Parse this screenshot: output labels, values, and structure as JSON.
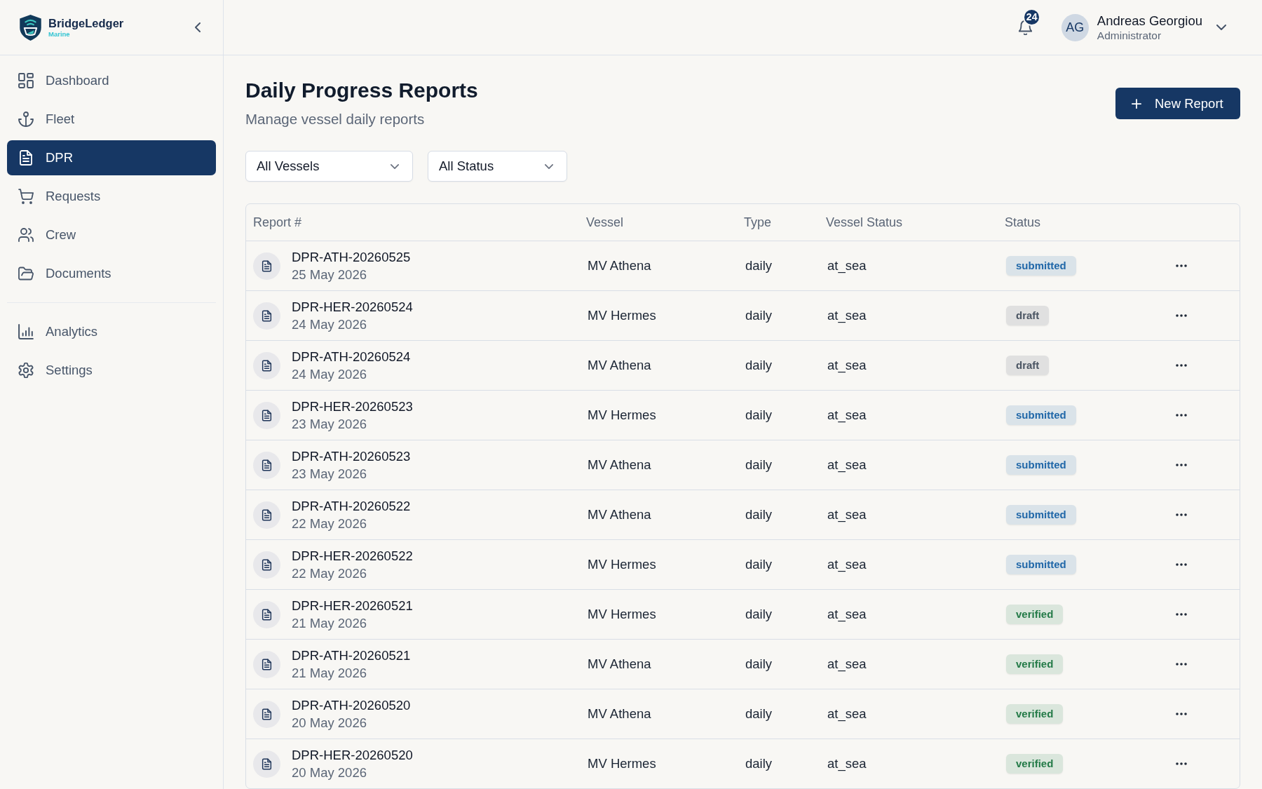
{
  "brand": {
    "name": "BridgeLedger",
    "tagline": "Marine"
  },
  "sidebar": {
    "sections": [
      {
        "items": [
          {
            "label": "Dashboard",
            "selected": false
          },
          {
            "label": "Fleet",
            "selected": false
          },
          {
            "label": "DPR",
            "selected": true
          },
          {
            "label": "Requests",
            "selected": false
          },
          {
            "label": "Crew",
            "selected": false
          },
          {
            "label": "Documents",
            "selected": false
          }
        ]
      },
      {
        "items": [
          {
            "label": "Analytics",
            "selected": false
          },
          {
            "label": "Settings",
            "selected": false
          }
        ]
      }
    ]
  },
  "header": {
    "notifications": {
      "count": "24"
    },
    "user": {
      "initials": "AG",
      "name": "Andreas Georgiou",
      "role": "Administrator"
    }
  },
  "page": {
    "title": "Daily Progress Reports",
    "subtitle": "Manage vessel daily reports",
    "new_report_button": "New Report"
  },
  "filters": [
    {
      "value": "All Vessels"
    },
    {
      "value": "All Status"
    }
  ],
  "table": {
    "columns": [
      "Report #",
      "Vessel",
      "Type",
      "Vessel Status",
      "Status"
    ],
    "rows": [
      {
        "report": "DPR-ATH-20260525",
        "date": "25 May 2026",
        "vessel": "MV Athena",
        "type": "daily",
        "vessel_status": "at_sea",
        "status": {
          "label": "submitted",
          "color": "#2067a8"
        }
      },
      {
        "report": "DPR-HER-20260524",
        "date": "24 May 2026",
        "vessel": "MV Hermes",
        "type": "daily",
        "vessel_status": "at_sea",
        "status": {
          "label": "draft",
          "color": "#4b5563"
        }
      },
      {
        "report": "DPR-ATH-20260524",
        "date": "24 May 2026",
        "vessel": "MV Athena",
        "type": "daily",
        "vessel_status": "at_sea",
        "status": {
          "label": "draft",
          "color": "#4b5563"
        }
      },
      {
        "report": "DPR-HER-20260523",
        "date": "23 May 2026",
        "vessel": "MV Hermes",
        "type": "daily",
        "vessel_status": "at_sea",
        "status": {
          "label": "submitted",
          "color": "#2067a8"
        }
      },
      {
        "report": "DPR-ATH-20260523",
        "date": "23 May 2026",
        "vessel": "MV Athena",
        "type": "daily",
        "vessel_status": "at_sea",
        "status": {
          "label": "submitted",
          "color": "#2067a8"
        }
      },
      {
        "report": "DPR-ATH-20260522",
        "date": "22 May 2026",
        "vessel": "MV Athena",
        "type": "daily",
        "vessel_status": "at_sea",
        "status": {
          "label": "submitted",
          "color": "#2067a8"
        }
      },
      {
        "report": "DPR-HER-20260522",
        "date": "22 May 2026",
        "vessel": "MV Hermes",
        "type": "daily",
        "vessel_status": "at_sea",
        "status": {
          "label": "submitted",
          "color": "#2067a8"
        }
      },
      {
        "report": "DPR-HER-20260521",
        "date": "21 May 2026",
        "vessel": "MV Hermes",
        "type": "daily",
        "vessel_status": "at_sea",
        "status": {
          "label": "verified",
          "color": "#237a47"
        }
      },
      {
        "report": "DPR-ATH-20260521",
        "date": "21 May 2026",
        "vessel": "MV Athena",
        "type": "daily",
        "vessel_status": "at_sea",
        "status": {
          "label": "verified",
          "color": "#237a47"
        }
      },
      {
        "report": "DPR-ATH-20260520",
        "date": "20 May 2026",
        "vessel": "MV Athena",
        "type": "daily",
        "vessel_status": "at_sea",
        "status": {
          "label": "verified",
          "color": "#237a47"
        }
      },
      {
        "report": "DPR-HER-20260520",
        "date": "20 May 2026",
        "vessel": "MV Hermes",
        "type": "daily",
        "vessel_status": "at_sea",
        "status": {
          "label": "verified",
          "color": "#237a47"
        }
      }
    ]
  }
}
